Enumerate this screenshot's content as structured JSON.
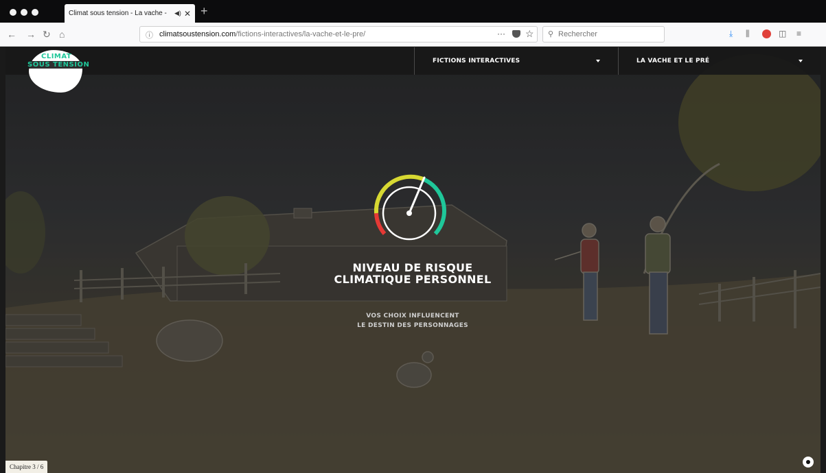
{
  "browser": {
    "tab": {
      "title": "Climat sous tension - La vache -",
      "audio_icon": "speaker-icon",
      "close": "✕"
    },
    "new_tab": "+",
    "nav": {
      "back": "←",
      "forward": "→",
      "reload": "↻",
      "home": "⌂"
    },
    "url": {
      "info_icon": "ⓘ",
      "domain": "climatsoustension.com",
      "path": "/fictions-interactives/la-vache-et-le-pre/",
      "more": "···",
      "star": "☆"
    },
    "search": {
      "placeholder": "Rechercher",
      "glass": "⚲"
    },
    "toolbar": {
      "download": "⤓",
      "library": "⫼",
      "sidebar": "◫",
      "menu": "≡"
    }
  },
  "site": {
    "logo": {
      "line1": "CLIMAT",
      "line2": "SOUS TENSION"
    },
    "header": {
      "menu1": "FICTIONS INTERACTIVES",
      "menu2": "LA VACHE ET LE PRÉ"
    },
    "risk": {
      "title_line1": "NIVEAU DE RISQUE",
      "title_line2": "CLIMATIQUE PERSONNEL",
      "subtitle_line1": "VOS CHOIX INFLUENCENT",
      "subtitle_line2": "LE DESTIN DES PERSONNAGES"
    },
    "chapter": "Chapitre 3 / 6",
    "colors": {
      "accent": "#1fc79a",
      "gauge_red": "#e53935",
      "gauge_yellow": "#d7d832",
      "gauge_green": "#1fc79a"
    }
  }
}
